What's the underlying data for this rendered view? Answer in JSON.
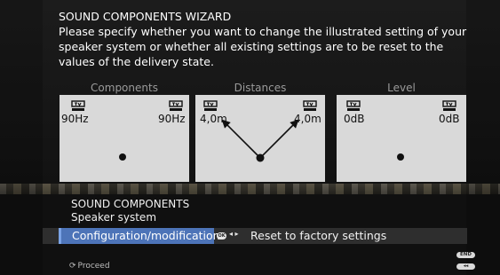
{
  "wizard": {
    "title": "SOUND COMPONENTS WIZARD",
    "description": "Please specify whether you want to change the illustrated setting of your speaker system or whether all existing settings are to be reset to the values of the delivery state."
  },
  "panels": [
    {
      "header": "Components",
      "left_value": "90Hz",
      "right_value": "90Hz"
    },
    {
      "header": "Distances",
      "left_value": "4,0m",
      "right_value": "4,0m"
    },
    {
      "header": "Level",
      "left_value": "0dB",
      "right_value": "0dB"
    }
  ],
  "section": {
    "title": "SOUND COMPONENTS",
    "subtitle": "Speaker system"
  },
  "options": {
    "selected": "Configuration/modification",
    "ok_key": "OK",
    "arrow_keys": "◂ ▸",
    "other": "Reset to factory settings"
  },
  "footer": {
    "proceed_icon": "⟳",
    "proceed_label": "Proceed",
    "end_key": "END",
    "back_key": "◂◂"
  },
  "colors": {
    "selection": "#4d74b8",
    "panel_bg": "#d9d9d9",
    "text": "#ffffff"
  },
  "icons": [
    "tv-speaker-icon",
    "listener-dot-icon",
    "ok-key-icon",
    "left-right-arrow-icon",
    "proceed-icon"
  ]
}
